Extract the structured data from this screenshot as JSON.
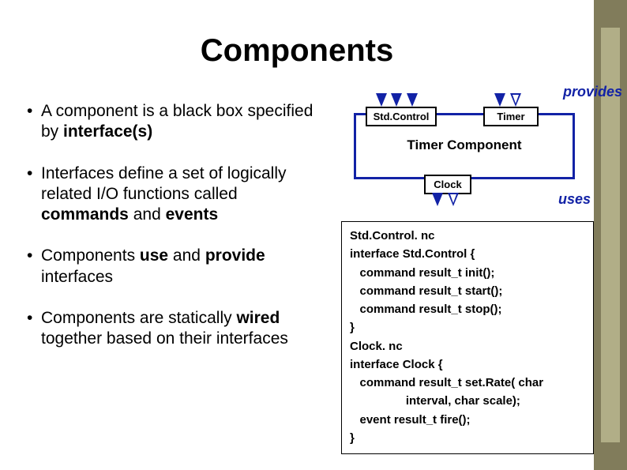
{
  "title": "Components",
  "bullets": [
    {
      "pre": "A component is a black box specified by ",
      "b1": "interface(s)",
      "post": ""
    },
    {
      "pre": "Interfaces define a set of logically related I/O functions called ",
      "b1": "commands",
      "mid": " and ",
      "b2": "events",
      "post": ""
    },
    {
      "pre": "Components ",
      "b1": "use",
      "mid": " and ",
      "b2": "provide",
      "post": " interfaces"
    },
    {
      "pre": "Components are statically ",
      "b1": "wired",
      "post": " together based on their interfaces"
    }
  ],
  "labels": {
    "provides": "provides",
    "uses": "uses",
    "stdcontrol": "Std.Control",
    "timer": "Timer",
    "clock": "Clock",
    "component": "Timer Component"
  },
  "code": {
    "l1": "Std.Control. nc",
    "l2": "interface Std.Control {",
    "l3": "   command result_t init();",
    "l4": "   command result_t start();",
    "l5": "   command result_t stop();",
    "l6": "}",
    "l7": "Clock. nc",
    "l8": "interface Clock {",
    "l9": "   command result_t set.Rate( char",
    "l10": "                 interval, char scale);",
    "l11": "   event result_t fire();",
    "l12": "}"
  }
}
